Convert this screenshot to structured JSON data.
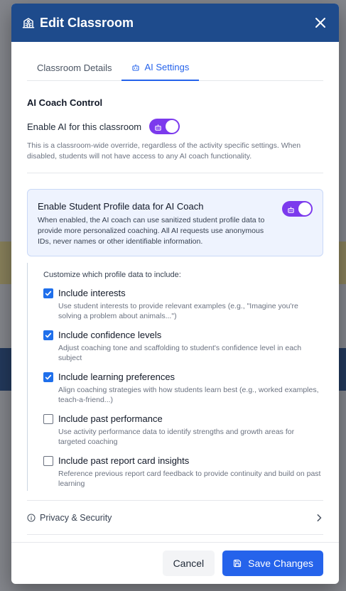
{
  "modal": {
    "title": "Edit Classroom",
    "title_icon": "school-icon",
    "close_icon": "close-icon"
  },
  "tabs": [
    {
      "label": "Classroom Details",
      "active": false
    },
    {
      "label": "AI Settings",
      "active": true,
      "icon": "bot-icon"
    }
  ],
  "ai_coach": {
    "section_title": "AI Coach Control",
    "enable_label": "Enable AI for this classroom",
    "enabled": true,
    "description": "This is a classroom-wide override, regardless of the activity specific settings. When disabled, students will not have access to any AI coach functionality."
  },
  "student_profile": {
    "title": "Enable Student Profile data for AI Coach",
    "enabled": true,
    "description": "When enabled, the AI coach can use sanitized student profile data to provide more personalized coaching. All AI requests use anonymous IDs, never names or other identifiable information."
  },
  "options": {
    "heading": "Customize which profile data to include:",
    "items": [
      {
        "title": "Include interests",
        "checked": true,
        "description": "Use student interests to provide relevant examples (e.g., \"Imagine you're solving a problem about animals...\")"
      },
      {
        "title": "Include confidence levels",
        "checked": true,
        "description": "Adjust coaching tone and scaffolding to student's confidence level in each subject"
      },
      {
        "title": "Include learning preferences",
        "checked": true,
        "description": "Align coaching strategies with how students learn best (e.g., worked examples, teach-a-friend...)"
      },
      {
        "title": "Include past performance",
        "checked": false,
        "description": "Use activity performance data to identify strengths and growth areas for targeted coaching"
      },
      {
        "title": "Include past report card insights",
        "checked": false,
        "description": "Reference previous report card feedback to provide continuity and build on past learning"
      }
    ]
  },
  "privacy": {
    "label": "Privacy & Security",
    "icon": "info-icon",
    "chevron": "chevron-right-icon"
  },
  "footer": {
    "cancel_label": "Cancel",
    "save_label": "Save Changes",
    "save_icon": "save-icon"
  },
  "colors": {
    "header": "#1e4b8c",
    "accent": "#2563eb",
    "toggle": "#7c3aed",
    "profile_box": "#eef3fe"
  }
}
